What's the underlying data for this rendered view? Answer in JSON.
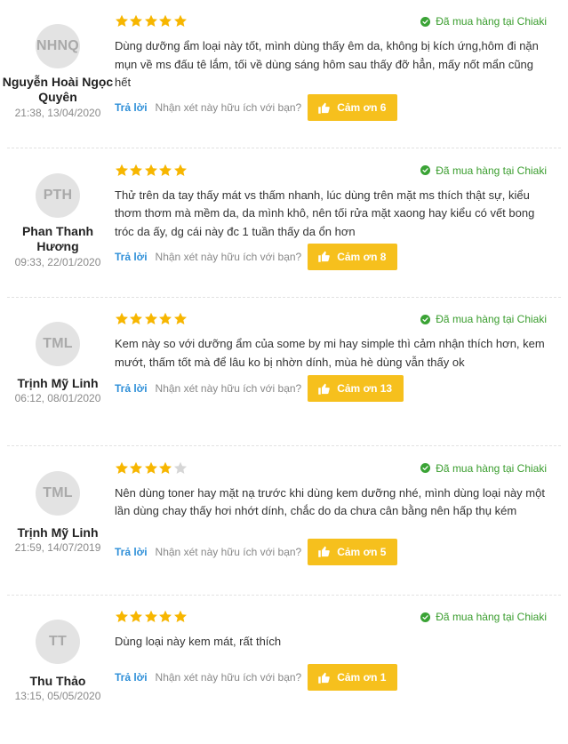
{
  "colors": {
    "star_filled": "#f7b600",
    "star_empty": "#d6d6d6",
    "verified": "#3a9d2e",
    "reply_link": "#2e8fd8",
    "thanks_button": "#f6c01d",
    "avatar_bg": "#e3e3e3"
  },
  "reviews": [
    {
      "initials": "NHNQ",
      "author": "Nguyễn Hoài Ngọc Quyên",
      "date": "21:38, 13/04/2020",
      "rating": 5,
      "verified_label": "Đã mua hàng tại Chiaki",
      "content": "Dùng dưỡng ẩm loại này tốt, mình dùng thấy êm da, không bị kích ứng,hôm đi nặn mụn về ms đấu tê lắm, tối về dùng sáng hôm sau thấy đỡ hẳn, mấy nốt mẩn cũng hết",
      "reply_label": "Trả lời",
      "helpful_label": "Nhận xét này hữu ích với bạn?",
      "thanks_label": "Cảm ơn 6"
    },
    {
      "initials": "PTH",
      "author": "Phan Thanh Hương",
      "date": "09:33, 22/01/2020",
      "rating": 5,
      "verified_label": "Đã mua hàng tại Chiaki",
      "content": "Thử trên da tay thấy mát vs thấm nhanh, lúc dùng trên mặt ms thích thật sự, kiểu thơm thơm mà mềm da, da mình khô, nên tối rửa mặt xaong hay kiểu có vết bong tróc da ấy, dg cái này đc 1 tuần thấy da ổn hơn",
      "reply_label": "Trả lời",
      "helpful_label": "Nhận xét này hữu ích với bạn?",
      "thanks_label": "Cảm ơn 8"
    },
    {
      "initials": "TML",
      "author": "Trịnh Mỹ Linh",
      "date": "06:12, 08/01/2020",
      "rating": 5,
      "verified_label": "Đã mua hàng tại Chiaki",
      "content": "Kem này so với dưỡng ẩm của some by mi hay simple thì cảm nhận thích hơn, kem mướt, thấm tốt mà để lâu ko bị nhờn dính, mùa hè dùng vẫn thấy ok",
      "reply_label": "Trả lời",
      "helpful_label": "Nhận xét này hữu ích với bạn?",
      "thanks_label": "Cảm ơn 13"
    },
    {
      "initials": "TML",
      "author": "Trịnh Mỹ Linh",
      "date": "21:59, 14/07/2019",
      "rating": 4,
      "verified_label": "Đã mua hàng tại Chiaki",
      "content": "Nên dùng toner hay mặt nạ trước khi dùng kem dưỡng nhé, mình dùng loại này một lần dùng chay thấy hơi nhớt dính, chắc do da chưa cân bằng nên hấp thụ kém",
      "reply_label": "Trả lời",
      "helpful_label": "Nhận xét này hữu ích với bạn?",
      "thanks_label": "Cảm ơn 5"
    },
    {
      "initials": "TT",
      "author": "Thu Thảo",
      "date": "13:15, 05/05/2020",
      "rating": 5,
      "verified_label": "Đã mua hàng tại Chiaki",
      "content": "Dùng loại này kem mát, rất thích",
      "reply_label": "Trả lời",
      "helpful_label": "Nhận xét này hữu ích với bạn?",
      "thanks_label": "Cảm ơn 1"
    }
  ]
}
